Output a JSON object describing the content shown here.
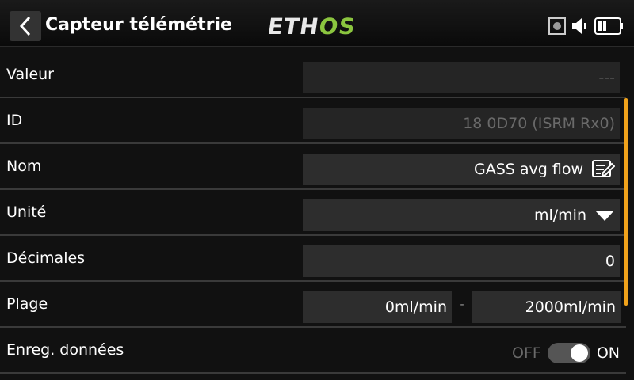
{
  "header": {
    "title": "Capteur télémétrie",
    "logo_eth": "ETH",
    "logo_os": "OS",
    "back_icon": "chevron-left-icon"
  },
  "status_icons": [
    "record-icon",
    "speaker-icon",
    "battery-icon"
  ],
  "rows": [
    {
      "label": "Valeur",
      "value": "---",
      "enabled": false
    },
    {
      "label": "ID",
      "value": "18 0D70 (ISRM Rx0)",
      "enabled": false
    },
    {
      "label": "Nom",
      "value": "GASS avg flow",
      "icon": "edit-icon"
    },
    {
      "label": "Unité",
      "value": "ml/min",
      "icon": "dropdown-arrow-icon"
    },
    {
      "label": "Décimales",
      "value": "0"
    },
    {
      "label": "Plage",
      "min": "0ml/min",
      "separator": "-",
      "max": "2000ml/min"
    },
    {
      "label": "Enreg. données",
      "off_label": "OFF",
      "on_label": "ON",
      "state": "on"
    }
  ],
  "colors": {
    "background": "#111111",
    "field": "#2d2d2d",
    "accent_scrollbar": "#f0a21b",
    "logo_green": "#8bc53f",
    "disabled_text": "#6a6a6a"
  }
}
